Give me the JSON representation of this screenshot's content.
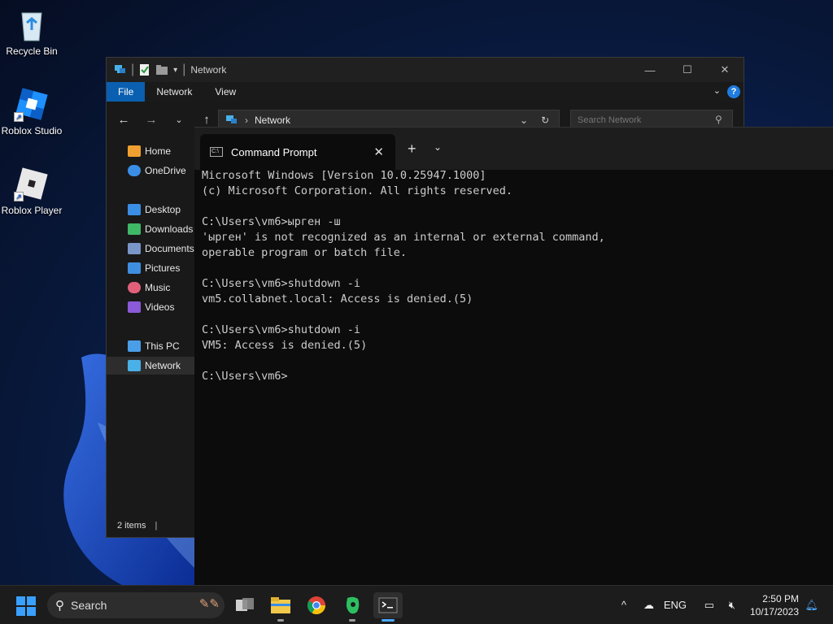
{
  "desktop": {
    "icons": [
      {
        "label": "Recycle Bin",
        "icon": "recycle-bin-icon"
      },
      {
        "label": "Roblox Studio",
        "icon": "roblox-studio-icon"
      },
      {
        "label": "Roblox Player",
        "icon": "roblox-player-icon"
      }
    ]
  },
  "explorer": {
    "title": "Network",
    "ribbon_tabs": [
      "File",
      "Network",
      "View"
    ],
    "address_path": "Network",
    "search_placeholder": "Search Network",
    "sidebar": [
      {
        "label": "Home",
        "icon": "home-icon",
        "color": "#f0a030"
      },
      {
        "label": "OneDrive",
        "icon": "onedrive-icon",
        "color": "#3a8ee6"
      },
      {
        "label": "Desktop",
        "icon": "desktop-folder-icon",
        "color": "#3a8ee6"
      },
      {
        "label": "Downloads",
        "icon": "downloads-icon",
        "color": "#3fb868"
      },
      {
        "label": "Documents",
        "icon": "documents-icon",
        "color": "#7a95c8"
      },
      {
        "label": "Pictures",
        "icon": "pictures-icon",
        "color": "#3f8fe0"
      },
      {
        "label": "Music",
        "icon": "music-icon",
        "color": "#e0607a"
      },
      {
        "label": "Videos",
        "icon": "videos-icon",
        "color": "#8a5ad8"
      },
      {
        "label": "This PC",
        "icon": "this-pc-icon",
        "color": "#4a9ee8"
      },
      {
        "label": "Network",
        "icon": "network-icon",
        "color": "#4ab0e8"
      }
    ],
    "active_sidebar": "Network",
    "status": "2 items"
  },
  "cmd": {
    "tab_title": "Command Prompt",
    "lines": [
      "Microsoft Windows [Version 10.0.25947.1000]",
      "(c) Microsoft Corporation. All rights reserved.",
      "",
      "C:\\Users\\vm6>ырген -ш",
      "'ырген' is not recognized as an internal or external command,",
      "operable program or batch file.",
      "",
      "C:\\Users\\vm6>shutdown -i",
      "vm5.collabnet.local: Access is denied.(5)",
      "",
      "C:\\Users\\vm6>shutdown -i",
      "VM5: Access is denied.(5)",
      "",
      "C:\\Users\\vm6>"
    ]
  },
  "taskbar": {
    "search_label": "Search",
    "apps": [
      "task-view-icon",
      "file-explorer-icon",
      "chrome-icon",
      "evernote-icon",
      "terminal-icon"
    ],
    "active_app": "terminal-icon",
    "tray": {
      "language": "ENG",
      "time": "2:50 PM",
      "date": "10/17/2023"
    }
  },
  "colors": {
    "accent": "#0a5fb0",
    "console_text": "#cccccc",
    "console_bg": "#0c0c0c",
    "taskbar_bg": "#1c1c1c"
  }
}
